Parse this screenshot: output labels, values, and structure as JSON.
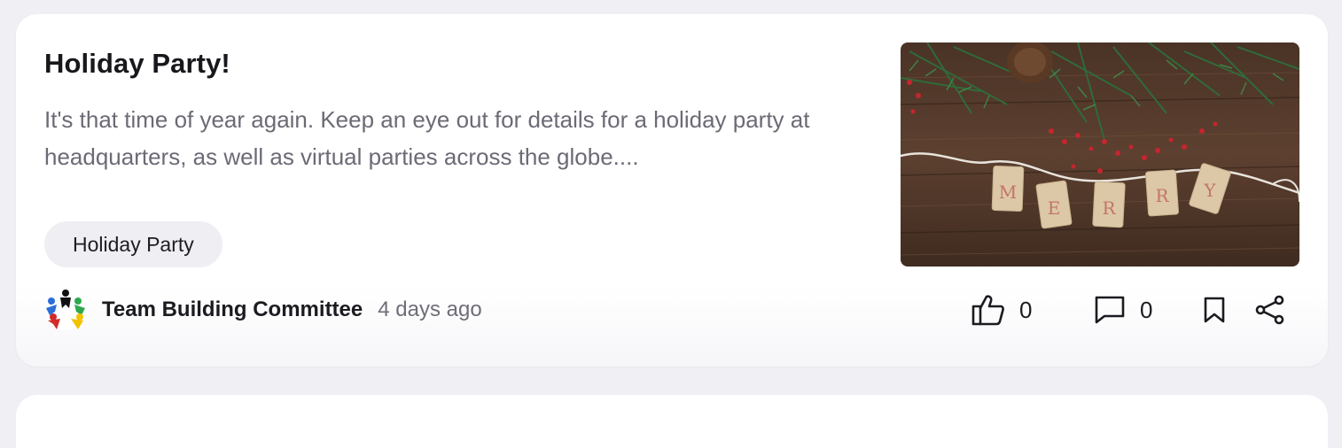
{
  "post": {
    "title": "Holiday Party!",
    "excerpt": "It's that time of year again. Keep an eye out for details for a holiday party at headquarters, as well as virtual parties across the globe....",
    "tag": "Holiday Party",
    "image": {
      "tag_letters": [
        "M",
        "E",
        "R",
        "R",
        "Y"
      ]
    },
    "author": {
      "name": "Team Building Committee",
      "avatar_icon": "people-circle-icon"
    },
    "time": "4 days ago",
    "actions": {
      "likes": "0",
      "comments": "0",
      "like_icon": "thumbs-up-icon",
      "comment_icon": "comment-icon",
      "bookmark_icon": "bookmark-icon",
      "share_icon": "share-icon"
    }
  },
  "colors": {
    "page_background": "#efeff4",
    "card": "#ffffff",
    "tag_background": "#eeeef3",
    "text_primary": "#17171c",
    "text_secondary": "#6b6b76"
  }
}
